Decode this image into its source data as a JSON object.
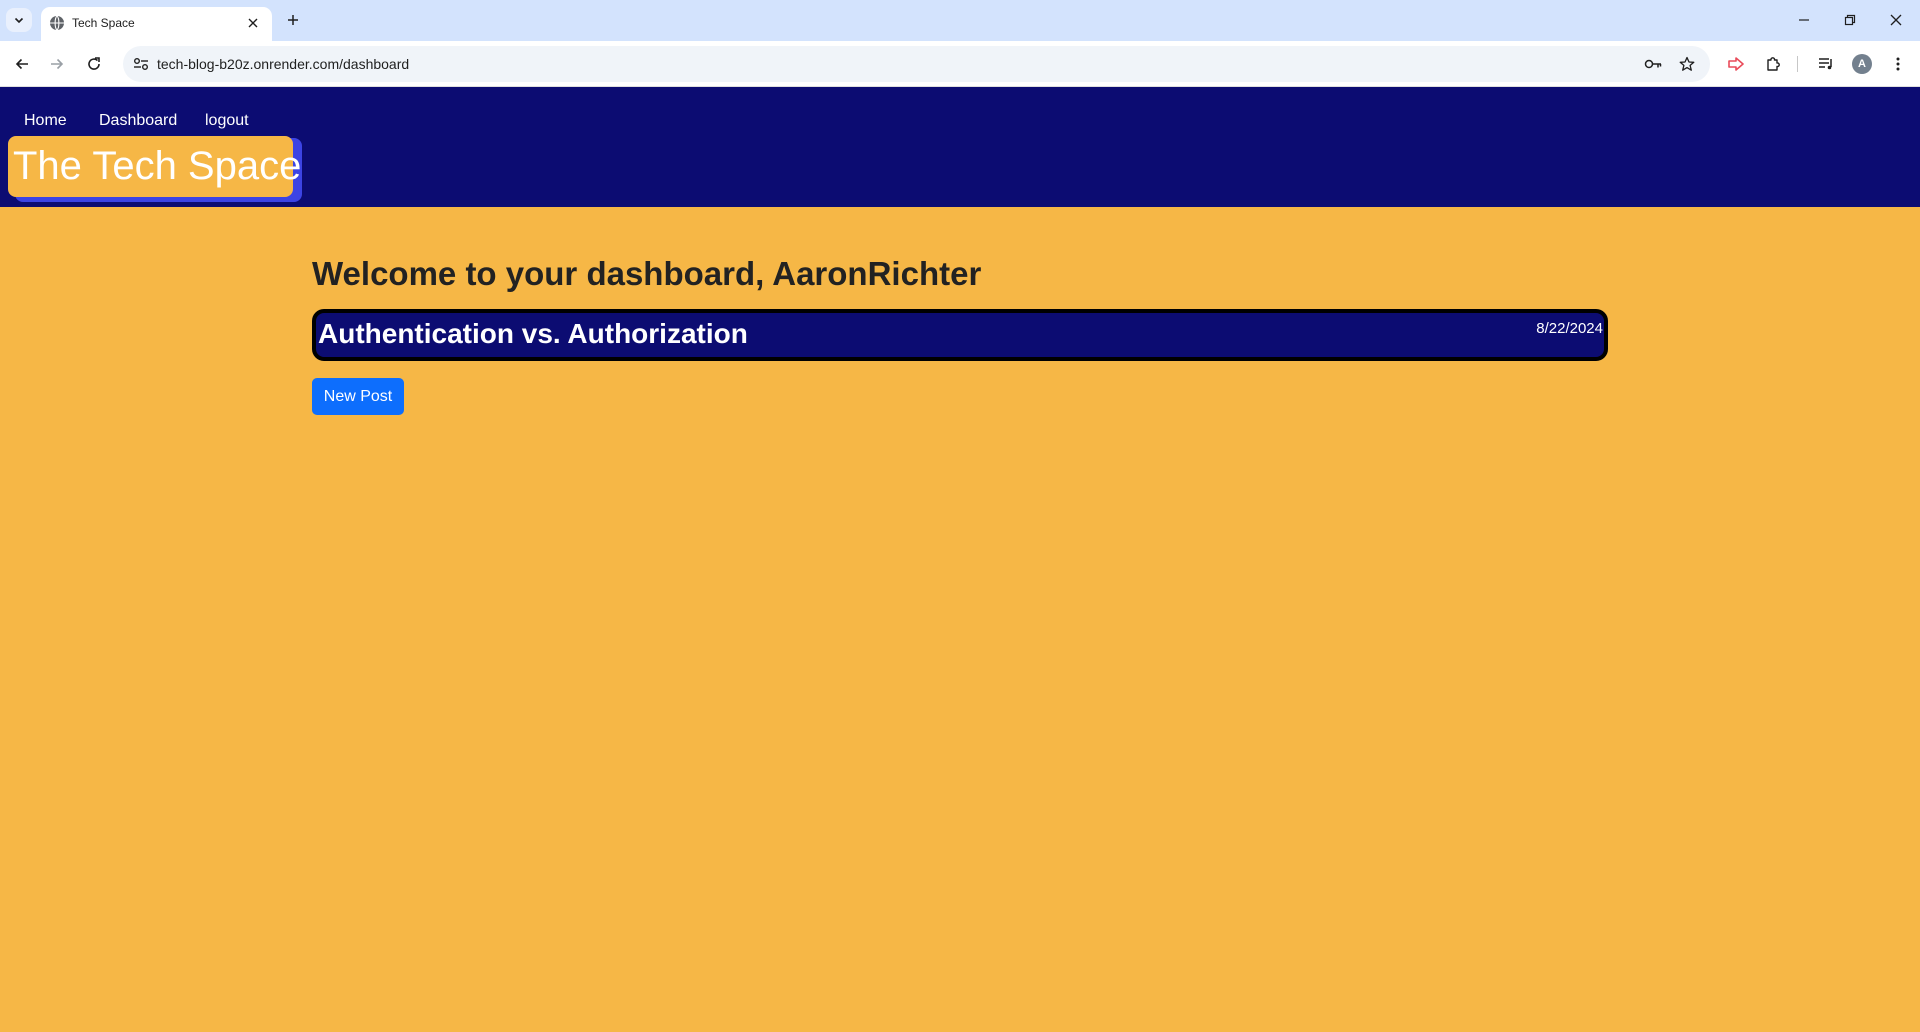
{
  "browser": {
    "tab_title": "Tech Space",
    "url": "tech-blog-b20z.onrender.com/dashboard",
    "profile_initial": "A"
  },
  "site": {
    "nav": [
      "Home",
      "Dashboard",
      "logout"
    ],
    "brand": "The Tech Space"
  },
  "dashboard": {
    "welcome": "Welcome to your dashboard, AaronRichter",
    "posts": [
      {
        "title": "Authentication vs. Authorization",
        "date": "8/22/2024"
      }
    ],
    "new_post_label": "New Post"
  },
  "colors": {
    "header_bg": "#0c0c72",
    "page_bg": "#f6b746",
    "brand_shadow": "#3c44e4",
    "button_blue": "#0d6efd"
  }
}
